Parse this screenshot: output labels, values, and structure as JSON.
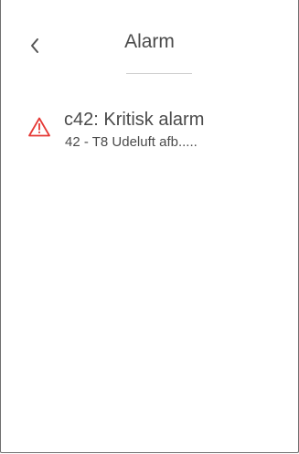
{
  "header": {
    "title": "Alarm",
    "back_icon": "chevron-left-icon"
  },
  "alarm": {
    "title": "c42: Kritisk alarm",
    "description": "42 - T8 Udeluft afb.....",
    "icon": "warning-triangle-icon",
    "icon_color": "#e53935"
  }
}
